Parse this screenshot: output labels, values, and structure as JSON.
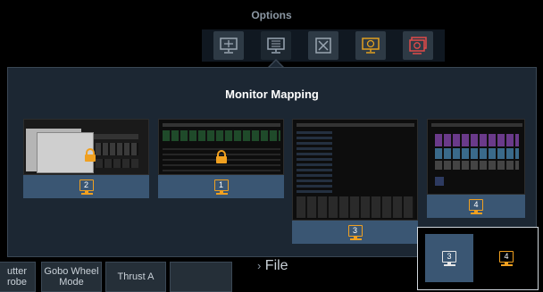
{
  "options": {
    "title": "Options",
    "buttons": [
      {
        "name": "add-monitor-button",
        "icon": "monitor-plus-icon",
        "color": "#9aa6b2"
      },
      {
        "name": "monitor-mapping-button",
        "icon": "monitor-list-icon",
        "color": "#9aa6b2",
        "selected": true
      },
      {
        "name": "close-monitor-button",
        "icon": "monitor-x-icon",
        "color": "#9aa6b2"
      },
      {
        "name": "refresh-monitor-button",
        "icon": "monitor-refresh-icon",
        "color": "#e0a020"
      },
      {
        "name": "reset-monitor-button",
        "icon": "monitor-reset-icon",
        "color": "#e04a4a"
      }
    ]
  },
  "monitor_mapping": {
    "title": "Monitor Mapping",
    "monitors": [
      {
        "number": "2",
        "locked": true
      },
      {
        "number": "1",
        "locked": true
      },
      {
        "number": "3",
        "locked": false
      },
      {
        "number": "4",
        "locked": false
      }
    ]
  },
  "bottom_bar": {
    "buttons": [
      "utter\nrobe",
      "Gobo Wheel\nMode",
      "Thrust A",
      ""
    ],
    "file_label": "File"
  },
  "popup": {
    "options": [
      {
        "number": "3",
        "selected": true
      },
      {
        "number": "4",
        "selected": false
      }
    ]
  },
  "colors": {
    "accent": "#f0a020",
    "panel": "#1c2733",
    "selected": "#3a5673",
    "danger": "#e04a4a"
  }
}
